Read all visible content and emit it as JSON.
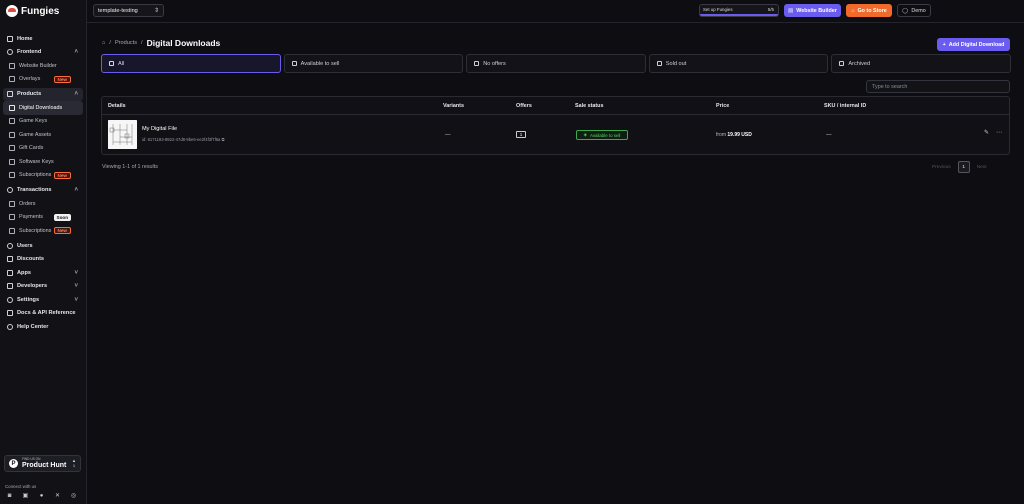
{
  "app": {
    "name": "Fungies"
  },
  "sidebar": {
    "home": "Home",
    "frontend": {
      "label": "Frontend",
      "items": [
        {
          "label": "Website Builder",
          "badge": ""
        },
        {
          "label": "Overlays",
          "badge": "New"
        }
      ]
    },
    "products": {
      "label": "Products",
      "items": [
        {
          "label": "Digital Downloads",
          "badge": ""
        },
        {
          "label": "Game Keys",
          "badge": ""
        },
        {
          "label": "Game Assets",
          "badge": ""
        },
        {
          "label": "Gift Cards",
          "badge": ""
        },
        {
          "label": "Software Keys",
          "badge": ""
        },
        {
          "label": "Subscriptions",
          "badge": "New"
        }
      ]
    },
    "transactions": {
      "label": "Transactions",
      "items": [
        {
          "label": "Orders",
          "badge": ""
        },
        {
          "label": "Payments",
          "badge": "Soon"
        },
        {
          "label": "Subscriptions",
          "badge": "New"
        }
      ]
    },
    "bottom": [
      "Users",
      "Discounts",
      "Apps",
      "Developers",
      "Settings",
      "Docs & API Reference",
      "Help Center"
    ],
    "product_hunt": {
      "small": "FIND US ON",
      "big": "Product Hunt",
      "count": "1"
    },
    "connect_label": "Connect with us"
  },
  "topbar": {
    "project": "template-testing",
    "setup_label": "Set up Fungies",
    "setup_count": "5/5",
    "setup_progress": 1.0,
    "website_builder": "Website Builder",
    "go_to_store": "Go to Store",
    "user": "Demo"
  },
  "page": {
    "breadcrumb_parent": "Products",
    "title": "Digital Downloads",
    "add_button": "Add Digital Download",
    "tabs": [
      "All",
      "Available to sell",
      "No offers",
      "Sold out",
      "Archived"
    ],
    "search_placeholder": "Type to search"
  },
  "table": {
    "headers": [
      "Details",
      "Variants",
      "Offers",
      "Sale status",
      "Price",
      "SKU / internal ID"
    ],
    "rows": [
      {
        "name": "My Digital File",
        "id": "id: 8171193-8922-47d8-9be6-ee2f4f3f7f6a",
        "variants": "—",
        "offers": "1",
        "status": "Available to sell",
        "price_prefix": "from",
        "price": "19.99 USD",
        "sku": "—"
      }
    ]
  },
  "footer": {
    "viewing": "Viewing 1-1 of 1 results",
    "previous": "Previous",
    "page": "1",
    "next": "Next"
  },
  "colors": {
    "accent": "#6b5cf0",
    "store": "#f06a2c",
    "success": "#5cd16a",
    "new_badge": "#ff6a3d"
  }
}
